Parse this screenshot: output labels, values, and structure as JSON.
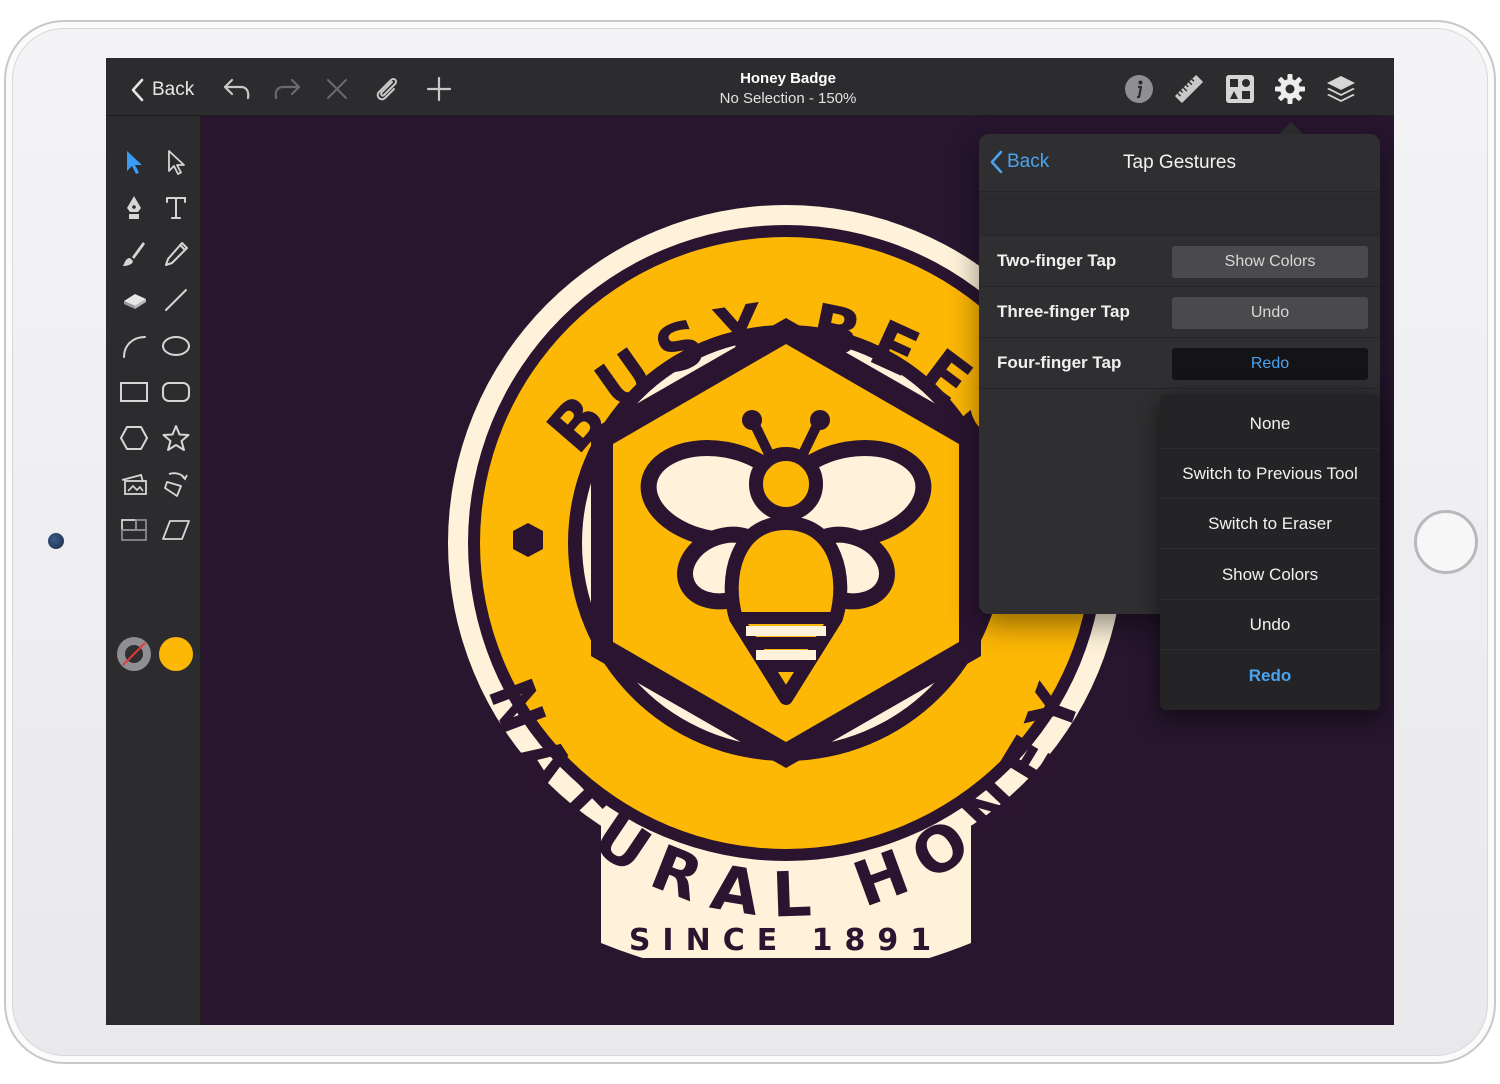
{
  "toolbar": {
    "back_label": "Back",
    "document_title": "Honey Badge",
    "document_status": "No Selection - 150%",
    "icons": [
      "chevron-left-icon",
      "undo-icon",
      "redo-icon",
      "delete-icon",
      "attach-icon",
      "add-icon",
      "info-icon",
      "ruler-icon",
      "grid-icon",
      "gear-icon",
      "layers-icon"
    ]
  },
  "tools": [
    "select-tool",
    "direct-select-tool",
    "pen-tool",
    "text-tool",
    "brush-tool",
    "pencil-tool",
    "eraser-tool",
    "line-tool",
    "arc-tool",
    "ellipse-tool",
    "rectangle-tool",
    "rounded-rectangle-tool",
    "polygon-tool",
    "star-tool",
    "image-tool",
    "transform-tool",
    "crop-tool",
    "skew-tool"
  ],
  "colors": {
    "stroke_swatch": "#2f2f31",
    "fill_swatch": "#fdb705",
    "canvas_background": "#27162e",
    "badge_yellow": "#fdb705",
    "badge_cream": "#fef3da",
    "badge_dark": "#2a1430",
    "accent": "#4aa3f0"
  },
  "artwork": {
    "top_text": "BUSY BEES",
    "bottom_text": "NATURAL HONEY",
    "ribbon_text": "SINCE 1891"
  },
  "popover": {
    "back_label": "Back",
    "title": "Tap Gestures",
    "rows": [
      {
        "label": "Two-finger Tap",
        "value": "Show Colors"
      },
      {
        "label": "Three-finger Tap",
        "value": "Undo"
      },
      {
        "label": "Four-finger Tap",
        "value": "Redo"
      }
    ]
  },
  "dropdown": {
    "options": [
      "None",
      "Switch to Previous Tool",
      "Switch to Eraser",
      "Show Colors",
      "Undo",
      "Redo"
    ],
    "selected": "Redo"
  }
}
